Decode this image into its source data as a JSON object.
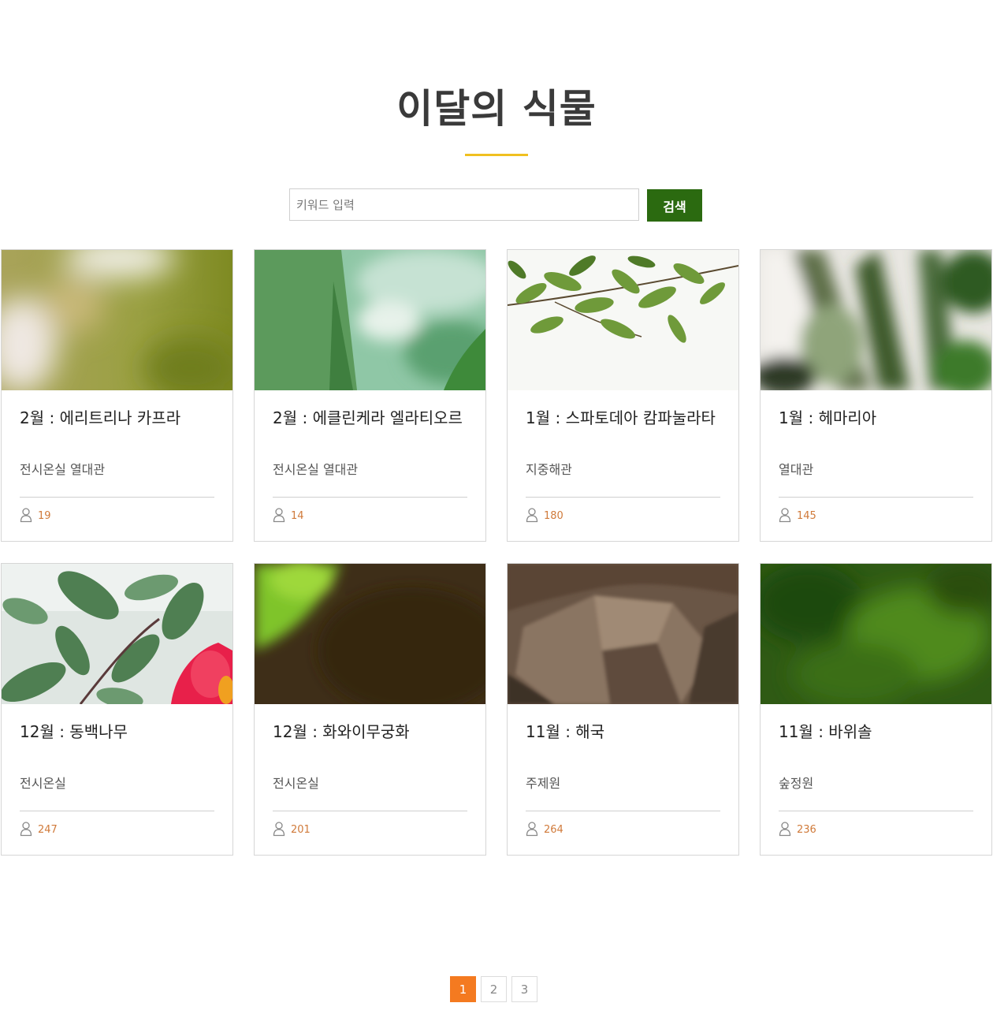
{
  "page": {
    "title": "이달의 식물",
    "accent_color": "#f0c020"
  },
  "search": {
    "placeholder": "키워드 입력",
    "value": "",
    "button_label": "검색",
    "button_color": "#2b6a10"
  },
  "cards": [
    {
      "title": "2월 : 에리트리나 카프라",
      "location": "전시온실 열대관",
      "views": "19",
      "image": "blurred yellow-green plant photo"
    },
    {
      "title": "2월 : 에클린케라 엘라티오르",
      "location": "전시온실 열대관",
      "views": "14",
      "image": "close-up green leaf photo"
    },
    {
      "title": "1월 : 스파토데아 캄파눌라타",
      "location": "지중해관",
      "views": "180",
      "image": "green leaves branch photo"
    },
    {
      "title": "1월 : 헤마리아",
      "location": "열대관",
      "views": "145",
      "image": "blurred dark green leaves photo"
    },
    {
      "title": "12월 : 동백나무",
      "location": "전시온실",
      "views": "247",
      "image": "camellia leaves with red flower photo"
    },
    {
      "title": "12월 : 화와이무궁화",
      "location": "전시온실",
      "views": "201",
      "image": "dark brown blurred photo with green leaf"
    },
    {
      "title": "11월 : 해국",
      "location": "주제원",
      "views": "264",
      "image": "rock close-up photo"
    },
    {
      "title": "11월 : 바위솔",
      "location": "숲정원",
      "views": "236",
      "image": "blurred green foliage photo"
    }
  ],
  "icons": {
    "views": "user-icon"
  },
  "views_color": "#d07a3a",
  "pagination": {
    "pages": [
      "1",
      "2",
      "3"
    ],
    "current": "1",
    "active_color": "#f47a20"
  }
}
